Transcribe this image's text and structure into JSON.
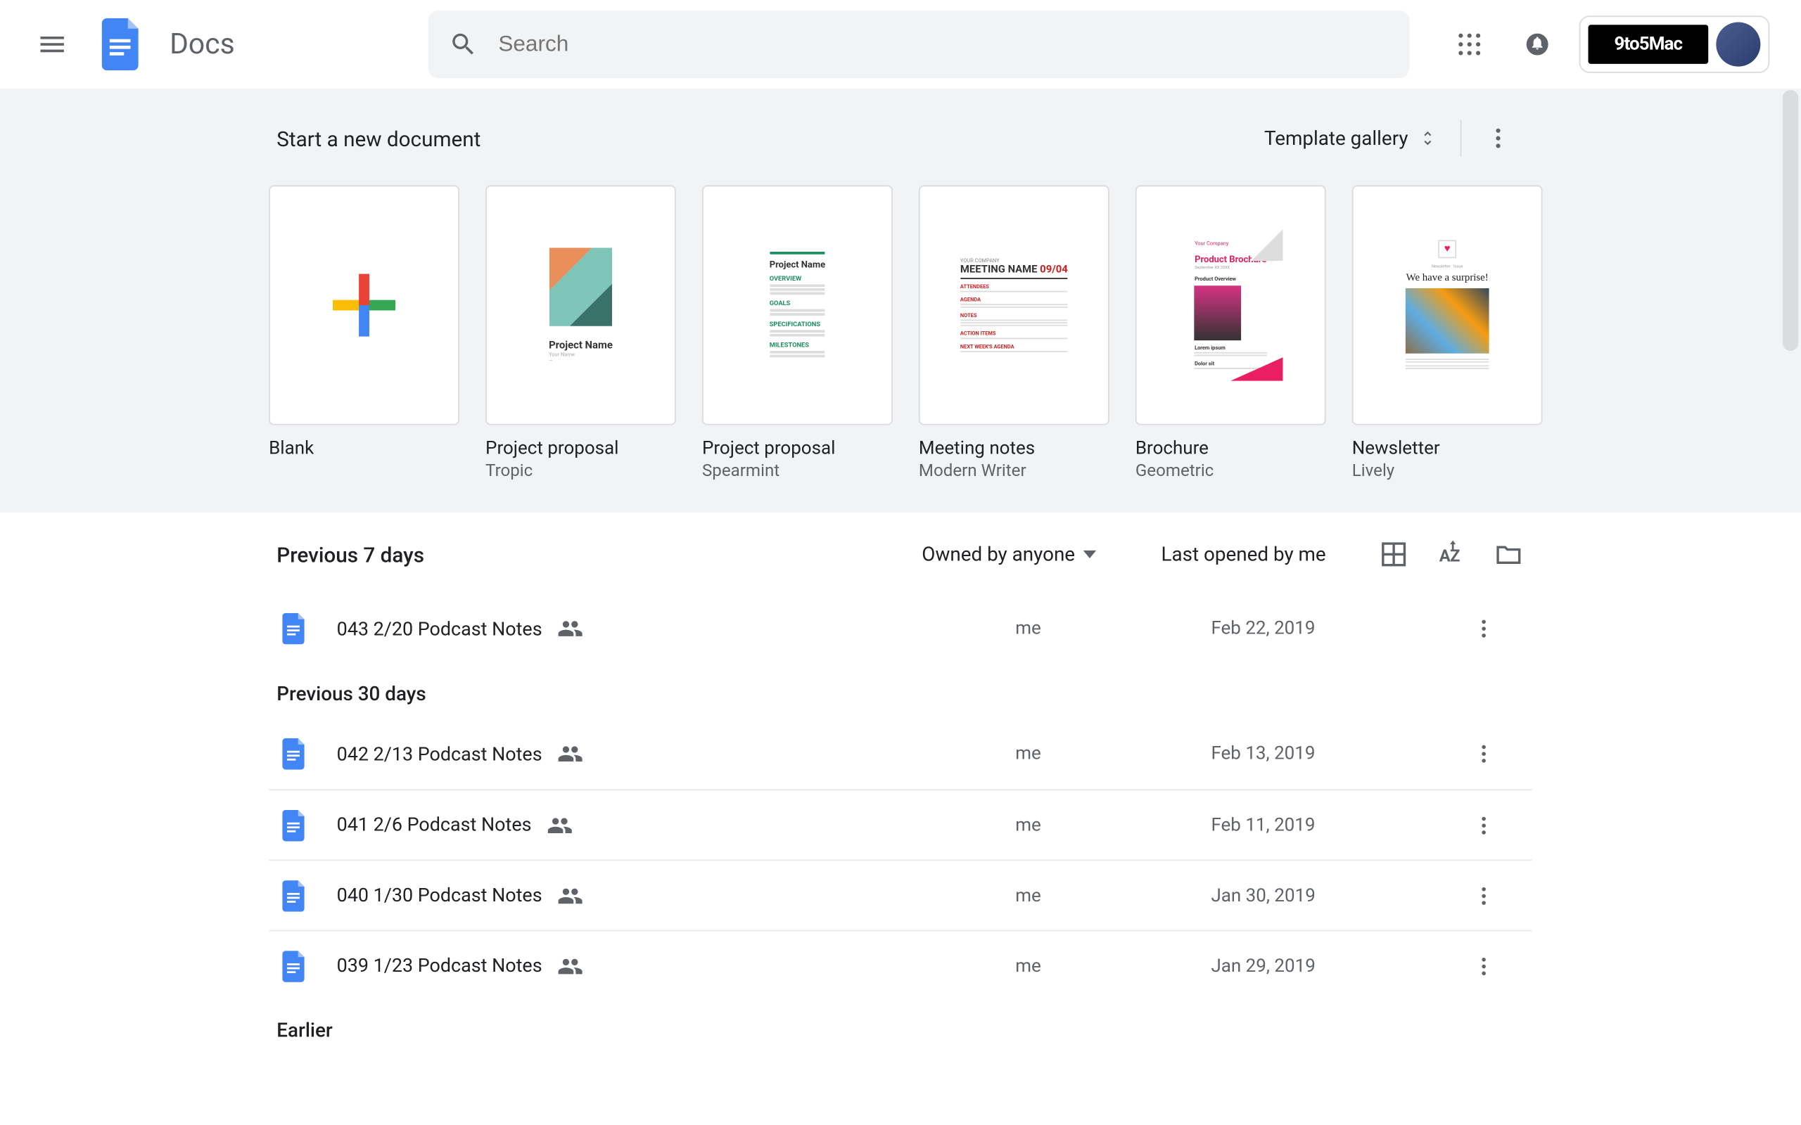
{
  "header": {
    "app_name": "Docs",
    "search_placeholder": "Search",
    "brand": "9to5Mac"
  },
  "templates": {
    "section_title": "Start a new document",
    "gallery_label": "Template gallery",
    "items": [
      {
        "name": "Blank",
        "sub": ""
      },
      {
        "name": "Project proposal",
        "sub": "Tropic"
      },
      {
        "name": "Project proposal",
        "sub": "Spearmint"
      },
      {
        "name": "Meeting notes",
        "sub": "Modern Writer"
      },
      {
        "name": "Brochure",
        "sub": "Geometric"
      },
      {
        "name": "Newsletter",
        "sub": "Lively"
      }
    ]
  },
  "list": {
    "filter_label": "Owned by anyone",
    "sort_label": "Last opened by me",
    "groups": [
      {
        "label": "Previous 7 days",
        "docs": [
          {
            "title": "043 2/20 Podcast Notes",
            "owner": "me",
            "date": "Feb 22, 2019",
            "shared": true
          }
        ]
      },
      {
        "label": "Previous 30 days",
        "docs": [
          {
            "title": "042 2/13 Podcast Notes",
            "owner": "me",
            "date": "Feb 13, 2019",
            "shared": true
          },
          {
            "title": "041 2/6 Podcast Notes",
            "owner": "me",
            "date": "Feb 11, 2019",
            "shared": true
          },
          {
            "title": "040 1/30 Podcast Notes",
            "owner": "me",
            "date": "Jan 30, 2019",
            "shared": true
          },
          {
            "title": "039 1/23 Podcast Notes",
            "owner": "me",
            "date": "Jan 29, 2019",
            "shared": true
          }
        ]
      },
      {
        "label": "Earlier",
        "docs": []
      }
    ]
  }
}
